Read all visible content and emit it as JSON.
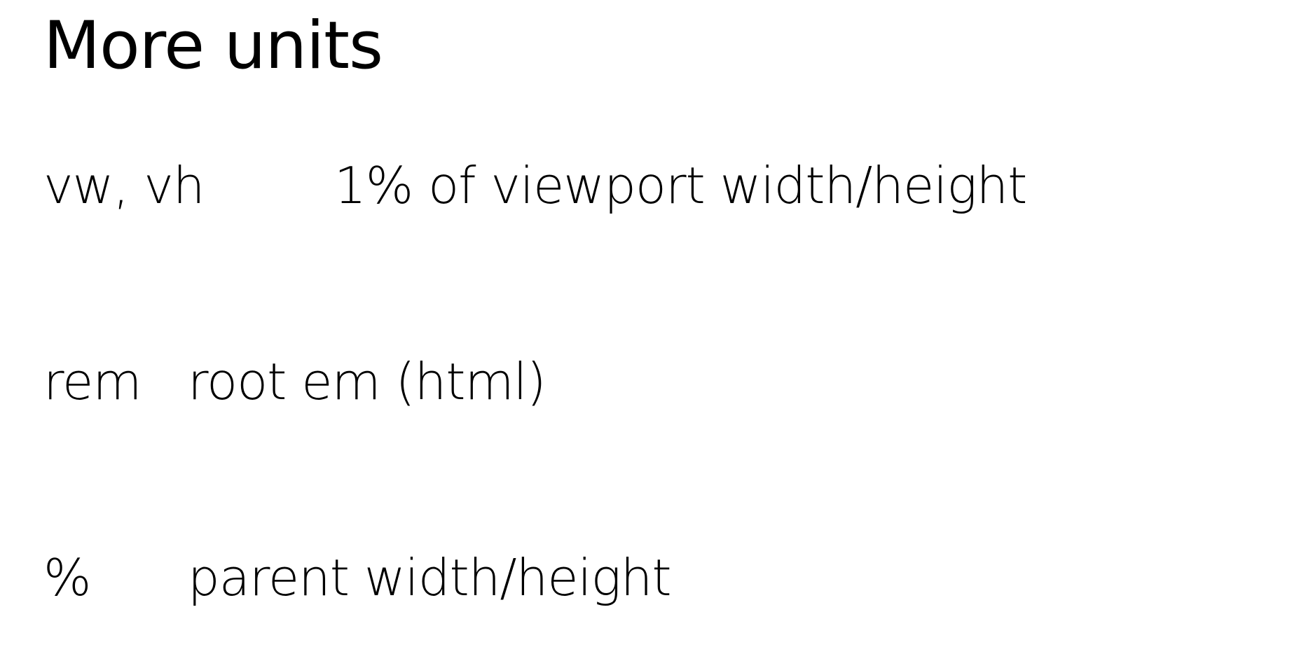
{
  "slide": {
    "title": "More units",
    "rows": [
      {
        "term": "vw, vh",
        "description": "1% of viewport width/height"
      },
      {
        "term": "rem",
        "description": "root em (html)"
      },
      {
        "term": "%",
        "description": "parent width/height"
      }
    ]
  }
}
